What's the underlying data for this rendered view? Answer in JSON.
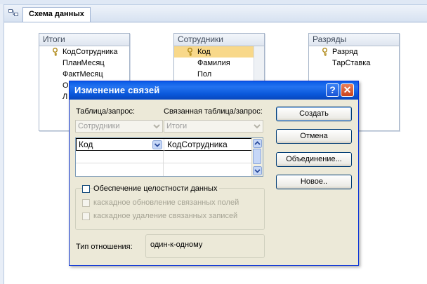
{
  "document_tab": {
    "label": "Схема данных"
  },
  "tables": [
    {
      "title": "Итоги",
      "fields": [
        "КодСотрудника",
        "ПланМесяц",
        "ФактМесяц",
        "О",
        "Л"
      ]
    },
    {
      "title": "Сотрудники",
      "fields": [
        "Код",
        "Фамилия",
        "Пол"
      ]
    },
    {
      "title": "Разряды",
      "fields": [
        "Разряд",
        "ТарСтавка"
      ]
    }
  ],
  "dialog": {
    "title": "Изменение связей",
    "help_glyph": "?",
    "close_glyph": "✕",
    "table_query_label": "Таблица/запрос:",
    "related_label": "Связанная таблица/запрос:",
    "table_value": "Сотрудники",
    "related_value": "Итоги",
    "fields_grid": {
      "left": "Код",
      "right": "КодСотрудника"
    },
    "integrity_label": "Обеспечение целостности данных",
    "cascade_update_label": "каскадное обновление связанных полей",
    "cascade_delete_label": "каскадное удаление связанных записей",
    "relationship_type_label": "Тип отношения:",
    "relationship_type_value": "один-к-одному",
    "buttons": {
      "create": "Создать",
      "cancel": "Отмена",
      "join": "Объединение...",
      "new": "Новое.."
    }
  },
  "colors": {
    "title_bar": "#0a5ce6",
    "selected_field": "#f8d88a",
    "dialog_bg": "#ece9d8"
  }
}
